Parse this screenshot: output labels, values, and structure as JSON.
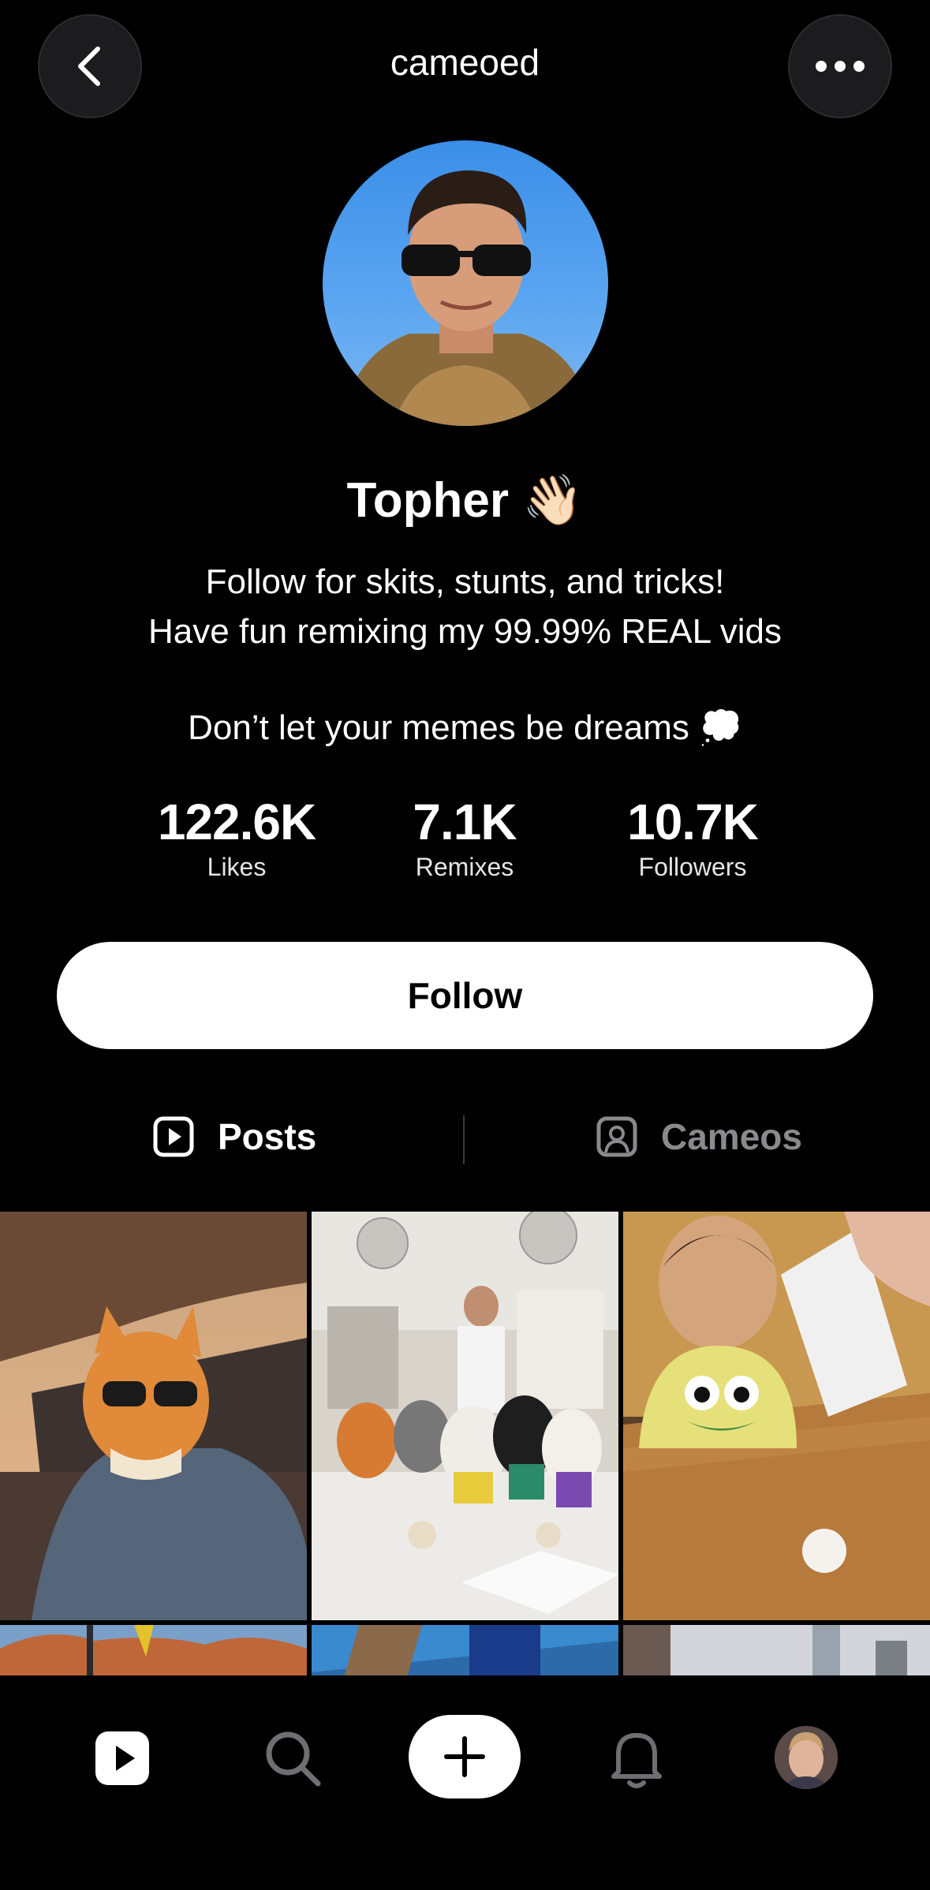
{
  "header": {
    "handle": "cameoed",
    "back_icon": "chevron-left-icon",
    "more_icon": "ellipsis-icon"
  },
  "profile": {
    "name": "Topher",
    "name_emoji": "👋🏻",
    "bio_line1": "Follow for skits, stunts, and tricks!",
    "bio_line2": "Have fun remixing my 99.99% REAL vids",
    "bio_line3": "Don’t let your memes be dreams",
    "bio_emoji": "💭"
  },
  "stats": [
    {
      "value": "122.6K",
      "label": "Likes"
    },
    {
      "value": "7.1K",
      "label": "Remixes"
    },
    {
      "value": "10.7K",
      "label": "Followers"
    }
  ],
  "follow_button": {
    "label": "Follow"
  },
  "tabs": [
    {
      "label": "Posts",
      "icon": "play-square-icon",
      "active": true
    },
    {
      "label": "Cameos",
      "icon": "person-square-icon",
      "active": false
    }
  ],
  "bottom_nav": [
    {
      "name": "home",
      "icon": "play-icon"
    },
    {
      "name": "search",
      "icon": "search-icon"
    },
    {
      "name": "create",
      "icon": "plus-icon"
    },
    {
      "name": "notifications",
      "icon": "bell-icon"
    },
    {
      "name": "profile",
      "icon": "avatar"
    }
  ],
  "colors": {
    "background": "#000000",
    "button_bg": "#ffffff",
    "inactive_text": "#8a8a8e"
  }
}
